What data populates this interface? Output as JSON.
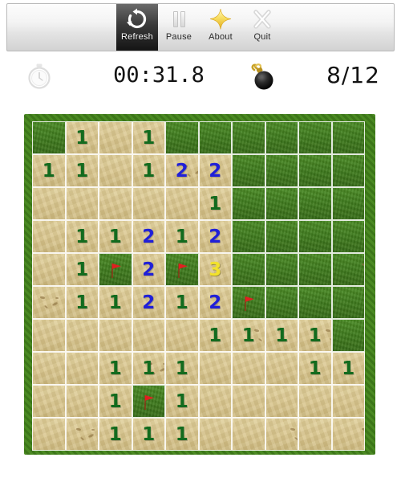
{
  "window": {
    "background_color": "#ffffff"
  },
  "toolbar": {
    "buttons": [
      {
        "id": "refresh",
        "label": "Refresh",
        "icon": "refresh-icon",
        "active": true
      },
      {
        "id": "pause",
        "label": "Pause",
        "icon": "pause-icon",
        "active": false
      },
      {
        "id": "about",
        "label": "About",
        "icon": "star-icon",
        "active": false
      },
      {
        "id": "quit",
        "label": "Quit",
        "icon": "close-x-icon",
        "active": false
      }
    ]
  },
  "status": {
    "timer_icon": "stopwatch-icon",
    "timer": "00:31.8",
    "mine_icon": "bomb-icon",
    "mine_counter": "8/12"
  },
  "board": {
    "rows": 10,
    "columns": 10,
    "colors": {
      "grass": "#3e7a1c",
      "sand": "#d7c389",
      "number_1": "#126b1e",
      "number_2": "#2020d8",
      "number_3": "#f2e22c",
      "flag": "#e02020"
    },
    "legend": {
      "grass": "covered cell",
      "sand": "revealed cell",
      "flag": "flagged mine"
    },
    "cells": [
      [
        {
          "s": "grass"
        },
        {
          "s": "sand",
          "n": "1"
        },
        {
          "s": "sand"
        },
        {
          "s": "sand",
          "n": "1"
        },
        {
          "s": "grass"
        },
        {
          "s": "grass"
        },
        {
          "s": "grass"
        },
        {
          "s": "grass"
        },
        {
          "s": "grass"
        },
        {
          "s": "grass"
        }
      ],
      [
        {
          "s": "sand",
          "n": "1"
        },
        {
          "s": "sand",
          "n": "1"
        },
        {
          "s": "sand"
        },
        {
          "s": "sand",
          "n": "1"
        },
        {
          "s": "sand",
          "n": "2",
          "d": 1
        },
        {
          "s": "sand",
          "n": "2"
        },
        {
          "s": "grass"
        },
        {
          "s": "grass"
        },
        {
          "s": "grass"
        },
        {
          "s": "grass"
        }
      ],
      [
        {
          "s": "sand"
        },
        {
          "s": "sand"
        },
        {
          "s": "sand"
        },
        {
          "s": "sand"
        },
        {
          "s": "sand"
        },
        {
          "s": "sand",
          "n": "1"
        },
        {
          "s": "grass"
        },
        {
          "s": "grass"
        },
        {
          "s": "grass"
        },
        {
          "s": "grass"
        }
      ],
      [
        {
          "s": "sand"
        },
        {
          "s": "sand",
          "n": "1"
        },
        {
          "s": "sand",
          "n": "1"
        },
        {
          "s": "sand",
          "n": "2"
        },
        {
          "s": "sand",
          "n": "1"
        },
        {
          "s": "sand",
          "n": "2"
        },
        {
          "s": "grass"
        },
        {
          "s": "grass"
        },
        {
          "s": "grass"
        },
        {
          "s": "grass"
        }
      ],
      [
        {
          "s": "sand"
        },
        {
          "s": "sand",
          "n": "1"
        },
        {
          "s": "grass",
          "f": true
        },
        {
          "s": "sand",
          "n": "2"
        },
        {
          "s": "grass",
          "f": true
        },
        {
          "s": "sand",
          "n": "3"
        },
        {
          "s": "grass"
        },
        {
          "s": "grass"
        },
        {
          "s": "grass"
        },
        {
          "s": "grass",
          "d": 1
        }
      ],
      [
        {
          "s": "sand",
          "d": 1
        },
        {
          "s": "sand",
          "n": "1"
        },
        {
          "s": "sand",
          "n": "1"
        },
        {
          "s": "sand",
          "n": "2"
        },
        {
          "s": "sand",
          "n": "1"
        },
        {
          "s": "sand",
          "n": "2"
        },
        {
          "s": "grass",
          "f": true
        },
        {
          "s": "grass"
        },
        {
          "s": "grass"
        },
        {
          "s": "grass"
        }
      ],
      [
        {
          "s": "sand"
        },
        {
          "s": "sand"
        },
        {
          "s": "sand"
        },
        {
          "s": "sand"
        },
        {
          "s": "sand"
        },
        {
          "s": "sand",
          "n": "1"
        },
        {
          "s": "sand",
          "n": "1",
          "d": 1
        },
        {
          "s": "sand",
          "n": "1"
        },
        {
          "s": "sand",
          "n": "1",
          "d": 1
        },
        {
          "s": "grass"
        }
      ],
      [
        {
          "s": "sand"
        },
        {
          "s": "sand"
        },
        {
          "s": "sand",
          "n": "1"
        },
        {
          "s": "sand",
          "n": "1",
          "d": 1
        },
        {
          "s": "sand",
          "n": "1"
        },
        {
          "s": "sand"
        },
        {
          "s": "sand"
        },
        {
          "s": "sand"
        },
        {
          "s": "sand",
          "n": "1"
        },
        {
          "s": "sand",
          "n": "1"
        }
      ],
      [
        {
          "s": "sand"
        },
        {
          "s": "sand"
        },
        {
          "s": "sand",
          "n": "1"
        },
        {
          "s": "grass",
          "f": true
        },
        {
          "s": "sand",
          "n": "1"
        },
        {
          "s": "sand"
        },
        {
          "s": "sand"
        },
        {
          "s": "sand"
        },
        {
          "s": "sand"
        },
        {
          "s": "sand"
        }
      ],
      [
        {
          "s": "sand"
        },
        {
          "s": "sand",
          "d": 1
        },
        {
          "s": "sand",
          "n": "1"
        },
        {
          "s": "sand",
          "n": "1"
        },
        {
          "s": "sand",
          "n": "1"
        },
        {
          "s": "sand"
        },
        {
          "s": "sand"
        },
        {
          "s": "sand",
          "d": 1
        },
        {
          "s": "sand"
        },
        {
          "s": "sand",
          "d": 1
        }
      ]
    ]
  }
}
